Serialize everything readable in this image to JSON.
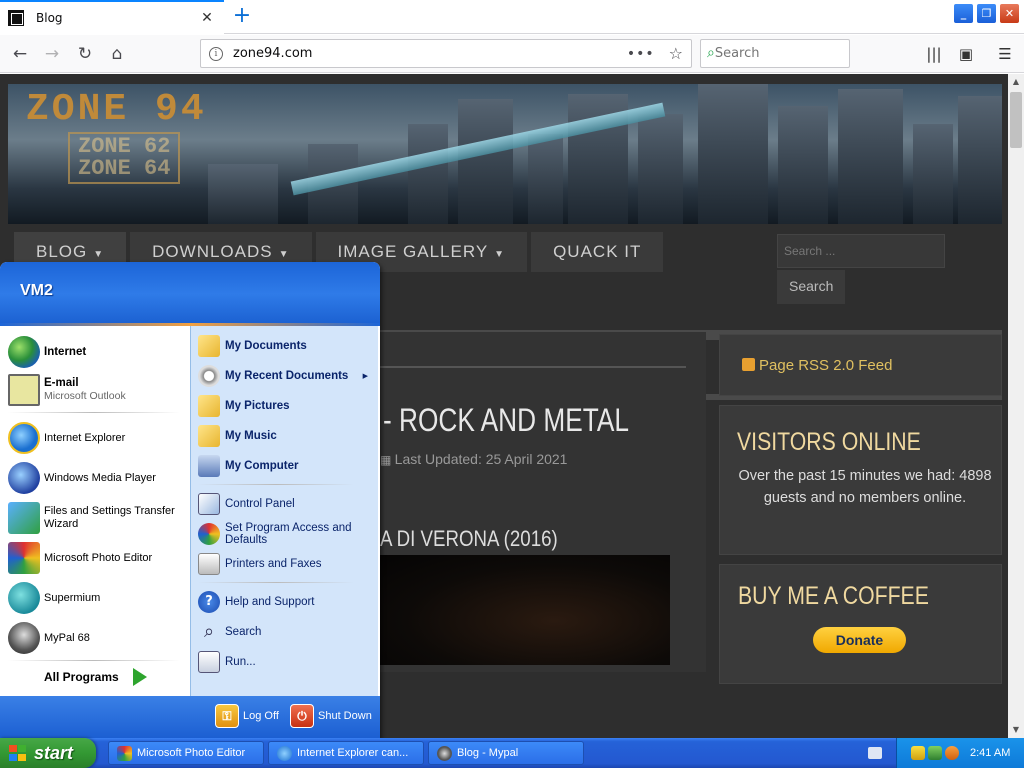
{
  "browser": {
    "tab_title": "Blog",
    "url": "zone94.com",
    "search_placeholder": "Search",
    "page_actions": "•••"
  },
  "site": {
    "logo_main": "ZONE 94",
    "logo_sub1": "ZONE 62",
    "logo_sub2": "ZONE 64",
    "menu": [
      {
        "label": "BLOG",
        "has_dropdown": true
      },
      {
        "label": "DOWNLOADS",
        "has_dropdown": true
      },
      {
        "label": "IMAGE GALLERY",
        "has_dropdown": true
      },
      {
        "label": "QUACK IT",
        "has_dropdown": false
      }
    ],
    "search_placeholder": "Search ...",
    "search_button": "Search",
    "article_title": "- ROCK AND METAL",
    "article_updated": "Last Updated: 25 April 2021",
    "article_subtitle": "A DI VERONA (2016)",
    "rss_label": "Page RSS 2.0 Feed",
    "visitors_title": "VISITORS ONLINE",
    "visitors_text": "Over the past 15 minutes we had: 4898 guests and no members online.",
    "coffee_title": "BUY ME A COFFEE",
    "donate_label": "Donate"
  },
  "start_menu": {
    "user": "VM2",
    "pinned": [
      {
        "label": "Internet",
        "sub": ""
      },
      {
        "label": "E-mail",
        "sub": "Microsoft Outlook"
      }
    ],
    "recent": [
      {
        "label": "Internet Explorer"
      },
      {
        "label": "Windows Media Player"
      },
      {
        "label": "Files and Settings Transfer Wizard"
      },
      {
        "label": "Microsoft Photo Editor"
      },
      {
        "label": "Supermium"
      },
      {
        "label": "MyPal 68"
      }
    ],
    "all_programs": "All Programs",
    "places": [
      {
        "label": "My Documents",
        "bold": true
      },
      {
        "label": "My Recent Documents",
        "bold": true
      },
      {
        "label": "My Pictures",
        "bold": true
      },
      {
        "label": "My Music",
        "bold": true
      },
      {
        "label": "My Computer",
        "bold": true
      }
    ],
    "system": [
      {
        "label": "Control Panel"
      },
      {
        "label": "Set Program Access and Defaults"
      },
      {
        "label": "Printers and Faxes"
      }
    ],
    "help": [
      {
        "label": "Help and Support"
      },
      {
        "label": "Search"
      },
      {
        "label": "Run..."
      }
    ],
    "log_off": "Log Off",
    "shut_down": "Shut Down"
  },
  "taskbar": {
    "start_label": "start",
    "tasks": [
      {
        "label": "Microsoft Photo Editor"
      },
      {
        "label": "Internet Explorer can..."
      },
      {
        "label": "Blog - Mypal"
      }
    ],
    "clock": "2:41 AM"
  },
  "colors": {
    "xp_blue": "#2458d0",
    "start_green": "#339933",
    "site_bg": "#2e2e2e",
    "site_accent": "#f0d9a0"
  }
}
